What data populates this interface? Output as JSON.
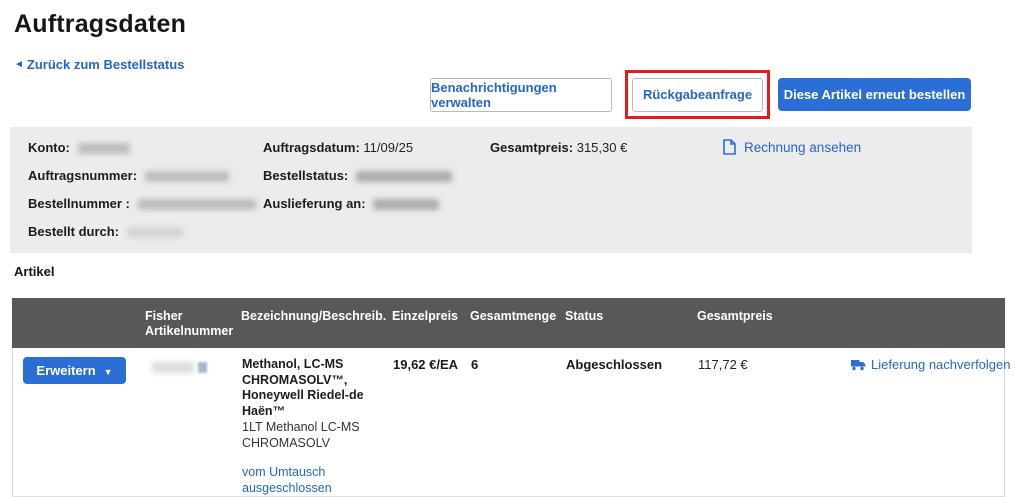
{
  "page": {
    "title": "Auftragsdaten"
  },
  "back_link": {
    "label": "Zurück zum Bestellstatus",
    "arrow": "◄"
  },
  "toolbar": {
    "manage_notifications_label": "Benachrichtigungen verwalten",
    "return_request_label": "Rückgabeanfrage",
    "reorder_label": "Diese Artikel erneut bestellen"
  },
  "order_summary": {
    "account_label": "Konto:",
    "order_number_label": "Auftragsnummer:",
    "po_number_label": "Bestellnummer :",
    "ordered_by_label": "Bestellt durch:",
    "order_date_label": "Auftragsdatum:",
    "order_date_value": "11/09/25",
    "order_status_label": "Bestellstatus:",
    "ship_to_label": "Auslieferung an:",
    "total_label": "Gesamtpreis:",
    "total_value": "315,30 €",
    "invoice_link_label": "Rechnung ansehen"
  },
  "items": {
    "heading": "Artikel",
    "columns": [
      "Fisher Artikelnummer",
      "Bezeichnung/Beschreib.",
      "Einzelpreis",
      "Gesamtmenge",
      "Status",
      "Gesamtpreis"
    ],
    "rows": [
      {
        "expand_label": "Erweitern",
        "expand_caret": "▼",
        "name": "Methanol, LC-MS CHROMASOLV™, Honeywell Riedel-de Haën™",
        "description": "1LT Methanol LC-MS CHROMASOLV",
        "exclusion_link_label": "vom Umtausch ausgeschlossen",
        "unit_price": "19,62 €/EA",
        "quantity": "6",
        "status": "Abgeschlossen",
        "total_price": "117,72 €",
        "track_link_label": "Lieferung nachverfolgen"
      }
    ]
  },
  "colors": {
    "accent_blue": "#2b6fd6",
    "link_blue": "#2366cc",
    "annotation_red": "#e01e1e",
    "table_header_gray": "#58585a",
    "summary_panel_gray": "#ececec"
  }
}
